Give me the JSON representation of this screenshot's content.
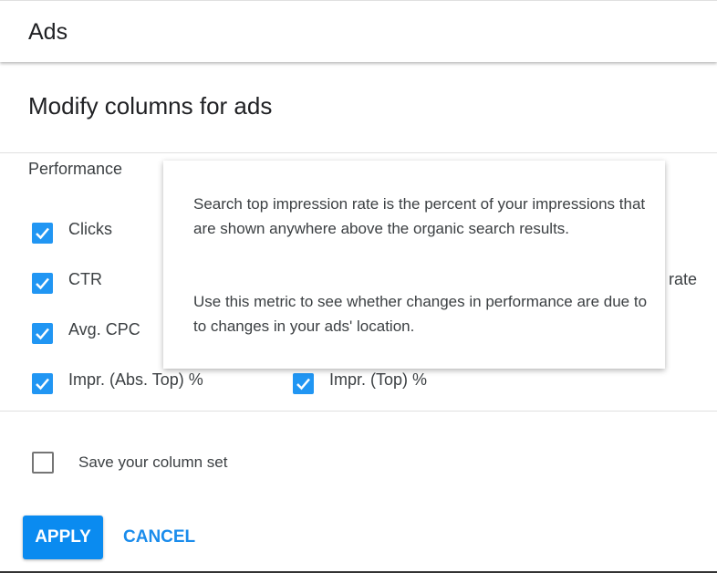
{
  "header": {
    "title": "Ads"
  },
  "dialog": {
    "title": "Modify columns for ads",
    "section": "Performance",
    "columns": [
      {
        "label": "Clicks",
        "checked": true
      },
      {
        "label": "CTR",
        "checked": true
      },
      {
        "label": "Avg. CPC",
        "checked": true
      },
      {
        "label": "Impr. (Abs. Top) %",
        "checked": true
      },
      {
        "label": "Impr. (Top) %",
        "checked": true
      }
    ],
    "partial_label": "n rate",
    "tooltip": {
      "para1": "Search top impression rate is the percent of your impressions that are shown anywhere above the organic search results.",
      "para2": "Use this metric to see whether changes in performance are due to to changes in your ads' location."
    },
    "save_set_label": "Save your column set",
    "save_set_checked": false,
    "apply_label": "APPLY",
    "cancel_label": "CANCEL"
  },
  "colors": {
    "accent": "#2196f3",
    "button": "#0a8bf0"
  }
}
